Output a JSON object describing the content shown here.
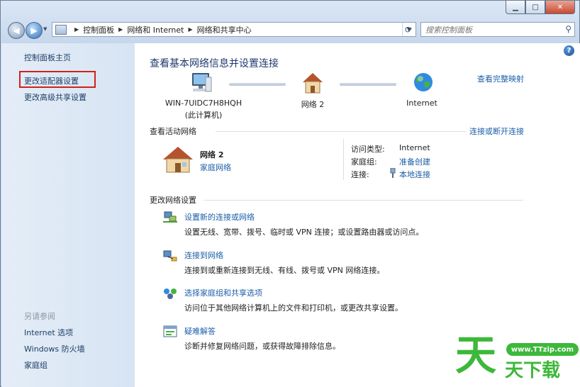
{
  "window": {
    "minimize_label": "▁",
    "maximize_label": "□",
    "close_label": "✕"
  },
  "nav": {
    "back_glyph": "◀",
    "forward_glyph": "▶",
    "breadcrumbs": [
      "控制面板",
      "网络和 Internet",
      "网络和共享中心"
    ],
    "search_placeholder": "搜索控制面板"
  },
  "sidebar": {
    "home": "控制面板主页",
    "items": [
      "更改适配器设置",
      "更改高级共享设置"
    ],
    "see_also_title": "另请参阅",
    "see_also": [
      "Internet 选项",
      "Windows 防火墙",
      "家庭组"
    ]
  },
  "main": {
    "heading": "查看基本网络信息并设置连接",
    "full_map_link": "查看完整映射",
    "nodes": [
      {
        "name": "WIN-7UIDC7H8HQH",
        "sub": "(此计算机)",
        "icon": "computer-icon"
      },
      {
        "name": "网络  2",
        "icon": "house-icon"
      },
      {
        "name": "Internet",
        "icon": "globe-icon"
      }
    ],
    "active_networks": {
      "title": "查看活动网络",
      "action_link": "连接或断开连接",
      "network_name": "网络  2",
      "network_type": "家庭网络",
      "props": [
        {
          "label": "访问类型:",
          "value": "Internet",
          "link": false
        },
        {
          "label": "家庭组:",
          "value": "准备创建",
          "link": true
        },
        {
          "label": "连接:",
          "value": "本地连接",
          "link": true
        }
      ]
    },
    "change_settings": {
      "title": "更改网络设置",
      "tasks": [
        {
          "link": "设置新的连接或网络",
          "desc": "设置无线、宽带、拨号、临时或 VPN 连接；或设置路由器或访问点。",
          "icon": "new-connection-icon"
        },
        {
          "link": "连接到网络",
          "desc": "连接到或重新连接到无线、有线、拨号或 VPN 网络连接。",
          "icon": "connect-network-icon"
        },
        {
          "link": "选择家庭组和共享选项",
          "desc": "访问位于其他网络计算机上的文件和打印机，或更改共享设置。",
          "icon": "homegroup-icon"
        },
        {
          "link": "疑难解答",
          "desc": "诊断并修复网络问题，或获得故障排除信息。",
          "icon": "troubleshoot-icon"
        }
      ]
    }
  },
  "watermark": {
    "url": "www.TTzip.com",
    "big": "天",
    "small": "天下载"
  },
  "colors": {
    "link": "#1c5ea8",
    "heading": "#1e3a6d",
    "highlight": "#d0221c",
    "watermark": "#3db83a"
  }
}
